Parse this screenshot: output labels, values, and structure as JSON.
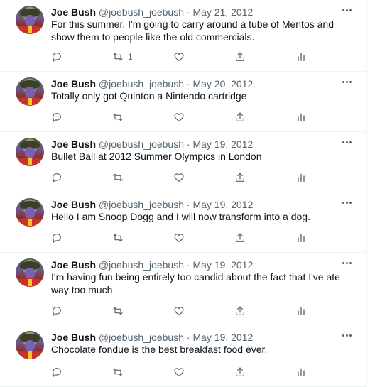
{
  "tweets": [
    {
      "name": "Joe Bush",
      "handle": "@joebush_joebush",
      "date": "May 21, 2012",
      "text": "For this summer, I'm going to carry around a tube of Mentos and show them to people like the old commercials.",
      "retweets": "1"
    },
    {
      "name": "Joe Bush",
      "handle": "@joebush_joebush",
      "date": "May 20, 2012",
      "text": "Totally only got Quinton a Nintendo cartridge",
      "retweets": ""
    },
    {
      "name": "Joe Bush",
      "handle": "@joebush_joebush",
      "date": "May 19, 2012",
      "text": "Bullet Ball at 2012 Summer Olympics in London",
      "retweets": ""
    },
    {
      "name": "Joe Bush",
      "handle": "@joebush_joebush",
      "date": "May 19, 2012",
      "text": "Hello I am Snoop Dogg and I will now transform into a dog.",
      "retweets": ""
    },
    {
      "name": "Joe Bush",
      "handle": "@joebush_joebush",
      "date": "May 19, 2012",
      "text": "I'm having fun being entirely too candid about the fact that I've ate way too much",
      "retweets": ""
    },
    {
      "name": "Joe Bush",
      "handle": "@joebush_joebush",
      "date": "May 19, 2012",
      "text": "Chocolate fondue is the best breakfast food ever.",
      "retweets": ""
    }
  ],
  "separator": "·",
  "icons": [
    "reply-icon",
    "retweet-icon",
    "like-icon",
    "share-icon",
    "analytics-icon",
    "more-icon"
  ],
  "colors": {
    "text": "#0f1419",
    "secondary": "#536471",
    "divider": "#eff3f4"
  }
}
